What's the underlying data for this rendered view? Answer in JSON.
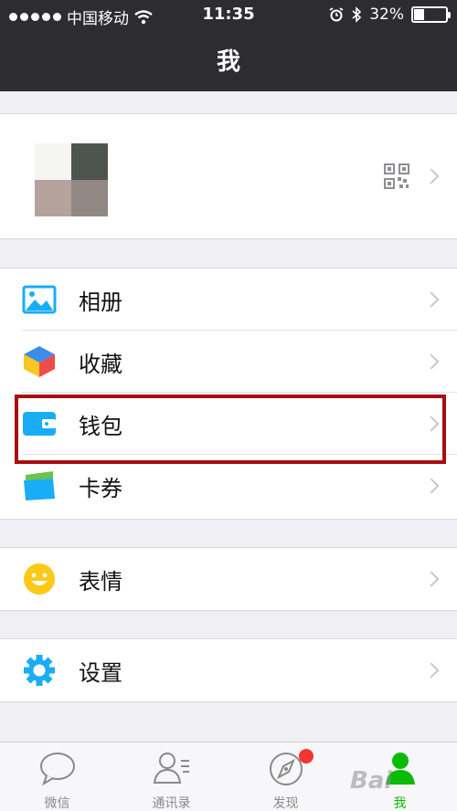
{
  "status_bar": {
    "carrier": "中国移动",
    "time": "11:35",
    "battery_percent": "32%",
    "battery_level": 0.32
  },
  "nav": {
    "title": "我"
  },
  "menu": {
    "album": "相册",
    "favorites": "收藏",
    "wallet": "钱包",
    "cards": "卡券",
    "stickers": "表情",
    "settings": "设置"
  },
  "tabs": [
    {
      "label": "微信",
      "icon": "chat-icon"
    },
    {
      "label": "通讯录",
      "icon": "contacts-icon"
    },
    {
      "label": "发现",
      "icon": "compass-icon"
    },
    {
      "label": "我",
      "icon": "me-icon"
    }
  ],
  "watermark": "Bai",
  "colors": {
    "header": "#2d2d31",
    "accent_green": "#09bb07",
    "highlight_box": "#a80d12",
    "icon_blue": "#1aadf5",
    "badge_red": "#f43530"
  }
}
